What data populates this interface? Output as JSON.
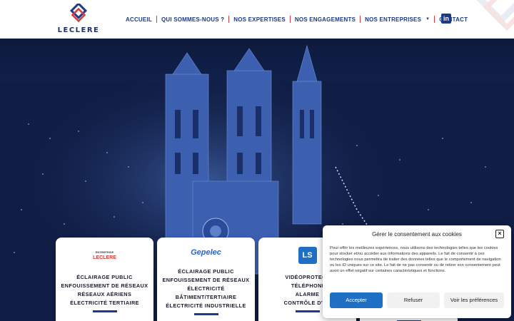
{
  "brand": {
    "logo_text": "LECLERE"
  },
  "nav": {
    "items": [
      {
        "label": "ACCUEIL"
      },
      {
        "label": "QUI SOMMES-NOUS ?"
      },
      {
        "label": "NOS EXPERTISES"
      },
      {
        "label": "NOS ENGAGEMENTS"
      },
      {
        "label": "NOS ENTREPRISES",
        "has_dropdown": true
      },
      {
        "label": "CONTACT"
      }
    ],
    "social_icon": "linkedin-icon",
    "linkedin_glyph": "in"
  },
  "colors": {
    "primary": "#1c3a8a",
    "accent": "#d63b3b",
    "button": "#1f6fc4"
  },
  "cards": [
    {
      "brand_top": "ENTREPRISE",
      "brand": "LECLERE",
      "lines": [
        "ÉCLAIRAGE PUBLIC",
        "ENFOUISSEMENT DE RÉSEAUX",
        "RÉSEAUX AÉRIENS",
        "ÉLECTRICITÉ TERTIAIRE"
      ]
    },
    {
      "brand": "Gepelec",
      "lines": [
        "ÉCLAIRAGE PUBLIC",
        "ENFOUISSEMENT DE RÉSEAUX",
        "ÉLECTRICITÉ",
        "BÂTIMENT/TERTIAIRE",
        "ÉLECTRICITÉ INDUSTRIELLE"
      ]
    },
    {
      "brand": "LS",
      "lines": [
        "VIDÉOPROTECT",
        "TÉLÉPHONI",
        "ALARME",
        "CONTRÔLE D'AC"
      ]
    }
  ],
  "cookie": {
    "title": "Gérer le consentement aux cookies",
    "close_glyph": "×",
    "text": "Pour offrir les meilleures expériences, nous utilisons des technologies telles que les cookies pour stocker et/ou accéder aux informations des appareils. Le fait de consentir à ces technologies nous permettra de traiter des données telles que le comportement de navigation ou les ID uniques sur ce site. Le fait de ne pas consentir ou de retirer son consentement peut avoir un effet négatif sur certaines caractéristiques et fonctions.",
    "accept": "Accepter",
    "refuse": "Refuser",
    "preferences": "Voir les préférences"
  }
}
